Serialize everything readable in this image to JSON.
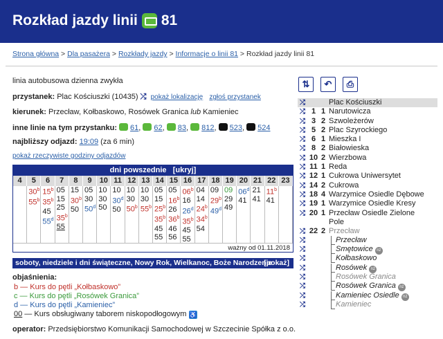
{
  "header": {
    "title": "Rozkład jazdy linii",
    "line": "81"
  },
  "crumbs": [
    "Strona główna",
    "Dla pasażera",
    "Rozkłady jazdy",
    "Informacje o linii 81",
    "Rozkład jazdy linii 81"
  ],
  "info": {
    "line_type": "linia autobusowa dzienna zwykła",
    "stop_label": "przystanek:",
    "stop_value": "Plac Kościuszki (10435)",
    "show_location": "pokaż lokalizację",
    "report_stop": "zgłoś przystanek",
    "direction_label": "kierunek:",
    "direction_value": "Przecław, Kołbaskowo, Rosówek Granica",
    "direction_or": "lub",
    "direction_last": "Kamieniec",
    "other_lines_label": "inne linie na tym przystanku:",
    "other_lines": [
      "61",
      "62",
      "83",
      "812",
      "523",
      "524"
    ],
    "next_label": "najbliższy odjazd:",
    "next_time": "19:09",
    "next_rest": "(za 6 min)",
    "realtime_link": "pokaż rzeczywiste godziny odjazdów"
  },
  "timetable": {
    "title": "dni powszednie",
    "flag": "[ukryj]",
    "hours": [
      "4",
      "5",
      "6",
      "7",
      "8",
      "9",
      "10",
      "11",
      "12",
      "13",
      "14",
      "15",
      "16",
      "17",
      "18",
      "19",
      "20",
      "21",
      "22",
      "23"
    ],
    "cols": [
      [],
      [
        {
          "t": "30",
          "s": "b",
          "c": "r"
        },
        {
          "t": "55",
          "s": "b",
          "c": "r"
        }
      ],
      [
        {
          "t": "15",
          "s": "b",
          "c": "r"
        },
        {
          "t": "35",
          "s": "b",
          "c": "r"
        },
        {
          "t": "45"
        },
        {
          "t": "55",
          "s": "d",
          "c": "bl"
        }
      ],
      [
        {
          "t": "05"
        },
        {
          "t": "15"
        },
        {
          "t": "25"
        },
        {
          "t": "35",
          "s": "b",
          "c": "r"
        },
        {
          "t": "55",
          "u": true
        }
      ],
      [
        {
          "t": "15"
        },
        {
          "t": "30",
          "s": "b",
          "c": "r"
        },
        {
          "t": "50"
        }
      ],
      [
        {
          "t": "05"
        },
        {
          "t": "30"
        },
        {
          "t": "50",
          "s": "d",
          "c": "bl"
        }
      ],
      [
        {
          "t": "10"
        },
        {
          "t": "30"
        },
        {
          "t": "50"
        }
      ],
      [
        {
          "t": "10"
        },
        {
          "t": "30",
          "s": "d",
          "c": "bl"
        },
        {
          "t": "50"
        }
      ],
      [
        {
          "t": "10"
        },
        {
          "t": "30"
        },
        {
          "t": "50",
          "s": "b",
          "c": "r"
        }
      ],
      [
        {
          "t": "10"
        },
        {
          "t": "30"
        },
        {
          "t": "55",
          "s": "b",
          "c": "r"
        }
      ],
      [
        {
          "t": "05"
        },
        {
          "t": "15"
        },
        {
          "t": "25",
          "s": "b",
          "c": "r"
        },
        {
          "t": "35",
          "s": "b",
          "c": "r"
        },
        {
          "t": "45"
        },
        {
          "t": "55"
        }
      ],
      [
        {
          "t": "05"
        },
        {
          "t": "16",
          "s": "b",
          "c": "r"
        },
        {
          "t": "26"
        },
        {
          "t": "36",
          "s": "b",
          "c": "r"
        },
        {
          "t": "46"
        },
        {
          "t": "56"
        }
      ],
      [
        {
          "t": "06",
          "s": "b",
          "c": "r"
        },
        {
          "t": "16"
        },
        {
          "t": "26",
          "s": "d",
          "c": "bl"
        },
        {
          "t": "35",
          "s": "b",
          "c": "r"
        },
        {
          "t": "45"
        },
        {
          "t": "55"
        }
      ],
      [
        {
          "t": "04"
        },
        {
          "t": "14"
        },
        {
          "t": "24",
          "s": "b",
          "c": "r"
        },
        {
          "t": "34",
          "s": "b",
          "c": "r"
        },
        {
          "t": "54"
        }
      ],
      [
        {
          "t": "09"
        },
        {
          "t": "29",
          "s": "b",
          "c": "r"
        },
        {
          "t": "49",
          "s": "d",
          "c": "bl"
        }
      ],
      [
        {
          "t": "09",
          "c": "gr"
        },
        {
          "t": "29"
        },
        {
          "t": "49"
        }
      ],
      [
        {
          "t": "06",
          "s": "d",
          "c": "bl"
        },
        {
          "t": "41"
        }
      ],
      [
        {
          "t": "21"
        },
        {
          "t": "41"
        }
      ],
      [
        {
          "t": "11",
          "s": "b",
          "c": "r"
        },
        {
          "t": "41"
        }
      ],
      []
    ],
    "valid_from": "ważny od 01.11.2018"
  },
  "weekend": {
    "title": "soboty, niedziele i dni świąteczne, Nowy Rok, Wielkanoc, Boże Narodzenie",
    "show": "[pokaż]"
  },
  "legend": {
    "title": "objaśnienia:",
    "items": [
      {
        "code": "b",
        "text": " — Kurs do pętli „Kołbaskowo”",
        "color": "#c0302a"
      },
      {
        "code": "c",
        "text": " — Kurs do pętli „Rosówek Granica”",
        "color": "#3a9a3a"
      },
      {
        "code": "d",
        "text": " — Kurs do pętli „Kamieniec”",
        "color": "#2a5fa8"
      }
    ],
    "lowfloor_code": "00",
    "lowfloor_text": " — Kurs obsługiwany taborem niskopodłogowym",
    "operator_label": "operator:",
    "operator_value": "Przedsiębiorstwo Komunikacji Samochodowej w Szczecinie Spółka z o.o."
  },
  "stops": [
    {
      "n1": "",
      "n2": "",
      "name": "Plac Kościuszki",
      "current": true
    },
    {
      "n1": "1",
      "n2": "1",
      "name": "Narutowicza"
    },
    {
      "n1": "3",
      "n2": "2",
      "name": "Szwoleżerów"
    },
    {
      "n1": "5",
      "n2": "2",
      "name": "Plac Szyrockiego"
    },
    {
      "n1": "6",
      "n2": "1",
      "name": "Mieszka I"
    },
    {
      "n1": "8",
      "n2": "2",
      "name": "Białowieska"
    },
    {
      "n1": "10",
      "n2": "2",
      "name": "Wierzbowa"
    },
    {
      "n1": "11",
      "n2": "1",
      "name": "Reda"
    },
    {
      "n1": "12",
      "n2": "1",
      "name": "Cukrowa Uniwersytet"
    },
    {
      "n1": "14",
      "n2": "2",
      "name": "Cukrowa"
    },
    {
      "n1": "18",
      "n2": "4",
      "name": "Warzymice Osiedle Dębowe"
    },
    {
      "n1": "19",
      "n2": "1",
      "name": "Warzymice Osiedle Kresy"
    },
    {
      "n1": "20",
      "n2": "1",
      "name": "Przecław Osiedle Zielone",
      "name2": "Pole"
    },
    {
      "n1": "22",
      "n2": "2",
      "name": "Przecław",
      "grey": true
    },
    {
      "var": true,
      "name": "Przecław"
    },
    {
      "var": true,
      "name": "Smętowice",
      "nz": true
    },
    {
      "var": true,
      "name": "Kołbaskowo"
    },
    {
      "var": true,
      "name": "Rosówek",
      "nz": true
    },
    {
      "var": true,
      "name": "Rosówek Granica",
      "grey": true
    },
    {
      "var": true,
      "name": "Rosówek Granica",
      "nz": true
    },
    {
      "var": true,
      "name": "Kamieniec Osiedle",
      "nz": true
    },
    {
      "var": true,
      "name": "Kamieniec",
      "grey": true
    }
  ],
  "nz_label": "nż",
  "icons": {
    "swap": "swap-direction-icon",
    "back": "back-icon",
    "print": "print-icon",
    "shuffle": "shuffle-icon",
    "bus": "bus-icon",
    "wheelchair": "wheelchair-icon"
  }
}
